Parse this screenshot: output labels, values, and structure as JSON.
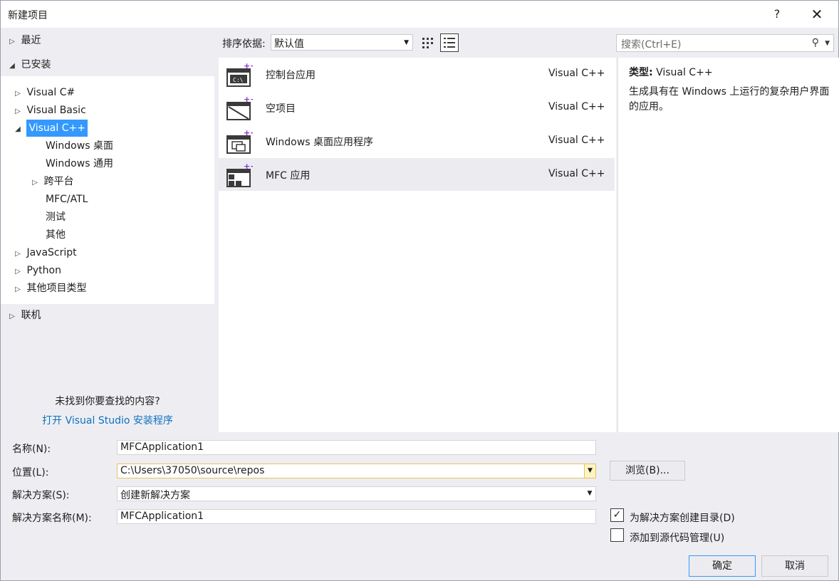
{
  "window": {
    "title": "新建项目",
    "help_label": "?",
    "close_label": "✕"
  },
  "left": {
    "recent": "最近",
    "installed": "已安装",
    "tree": [
      {
        "label": "Visual C#",
        "expander": "▷"
      },
      {
        "label": "Visual Basic",
        "expander": "▷"
      },
      {
        "label": "Visual C++",
        "expander": "◢"
      },
      {
        "label": "Windows 桌面",
        "expander": ""
      },
      {
        "label": "Windows 通用",
        "expander": ""
      },
      {
        "label": "跨平台",
        "expander": "▷"
      },
      {
        "label": "MFC/ATL",
        "expander": ""
      },
      {
        "label": "测试",
        "expander": ""
      },
      {
        "label": "其他",
        "expander": ""
      },
      {
        "label": "JavaScript",
        "expander": "▷"
      },
      {
        "label": "Python",
        "expander": "▷"
      },
      {
        "label": "其他项目类型",
        "expander": "▷"
      }
    ],
    "online": "联机",
    "not_found": "未找到你要查找的内容?",
    "install_link": "打开 Visual Studio 安装程序"
  },
  "toolbar": {
    "sort_label": "排序依据:",
    "sort_value": "默认值",
    "search_placeholder": "搜索(Ctrl+E)"
  },
  "templates": [
    {
      "name": "控制台应用",
      "lang": "Visual C++",
      "icon": "console-app-icon"
    },
    {
      "name": "空项目",
      "lang": "Visual C++",
      "icon": "empty-project-icon"
    },
    {
      "name": "Windows 桌面应用程序",
      "lang": "Visual C++",
      "icon": "windows-desktop-app-icon"
    },
    {
      "name": "MFC 应用",
      "lang": "Visual C++",
      "icon": "mfc-app-icon"
    }
  ],
  "info": {
    "type_label": "类型:",
    "type_value": "Visual C++",
    "description": "生成具有在 Windows 上运行的复杂用户界面的应用。"
  },
  "form": {
    "name_label": "名称(N):",
    "name_value": "MFCApplication1",
    "location_label": "位置(L):",
    "location_value": "C:\\Users\\37050\\source\\repos",
    "solution_label": "解决方案(S):",
    "solution_value": "创建新解决方案",
    "solution_name_label": "解决方案名称(M):",
    "solution_name_value": "MFCApplication1",
    "browse_label": "浏览(B)...",
    "create_dir_label": "为解决方案创建目录(D)",
    "create_dir_checked": true,
    "source_control_label": "添加到源代码管理(U)",
    "source_control_checked": false
  },
  "buttons": {
    "ok": "确定",
    "cancel": "取消"
  },
  "colors": {
    "selection": "#3399ff",
    "link": "#0e70c0",
    "panel": "#eeeef2"
  }
}
